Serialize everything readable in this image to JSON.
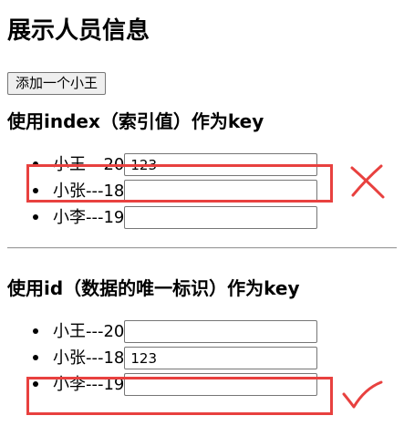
{
  "page": {
    "title": "展示人员信息",
    "add_button_label": "添加一个小王"
  },
  "section_index": {
    "heading": "使用index（索引值）作为key",
    "items": [
      {
        "label": "小王---20",
        "input_value": "123"
      },
      {
        "label": "小张---18",
        "input_value": ""
      },
      {
        "label": "小李---19",
        "input_value": ""
      }
    ],
    "annotation": "cross-mark-icon"
  },
  "section_id": {
    "heading": "使用id（数据的唯一标识）作为key",
    "items": [
      {
        "label": "小王---20",
        "input_value": ""
      },
      {
        "label": "小张---18",
        "input_value": "123"
      },
      {
        "label": "小李---19",
        "input_value": ""
      }
    ],
    "annotation": "check-mark-icon"
  },
  "colors": {
    "annotation_red": "#e8413f"
  }
}
